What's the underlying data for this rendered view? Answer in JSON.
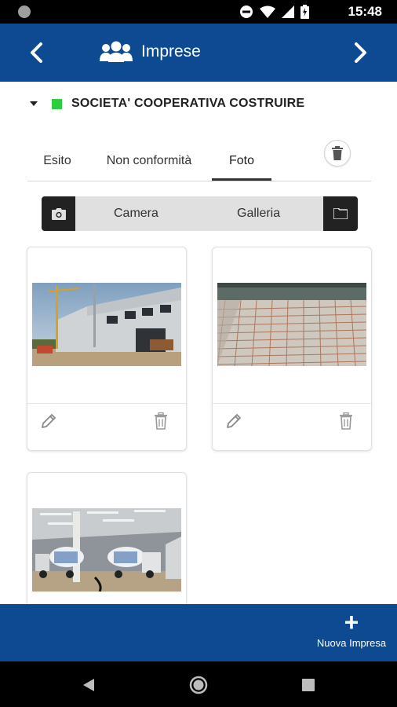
{
  "status_bar": {
    "time": "15:48",
    "icons": [
      "dnd-icon",
      "wifi-icon",
      "signal-icon",
      "battery-icon"
    ]
  },
  "app_bar": {
    "title": "Imprese",
    "icon": "group-icon",
    "colors": {
      "background": "#0d4a91",
      "foreground": "#ffffff"
    }
  },
  "company": {
    "name": "SOCIETA' COOPERATIVA COSTRUIRE",
    "status_color": "#2ecc40"
  },
  "tabs": [
    {
      "label": "Esito",
      "active": false
    },
    {
      "label": "Non conformità",
      "active": false
    },
    {
      "label": "Foto",
      "active": true
    }
  ],
  "source_selector": {
    "camera_label": "Camera",
    "gallery_label": "Galleria"
  },
  "photos": [
    {
      "subject": "industrial building under construction with crane"
    },
    {
      "subject": "rebar mesh on concrete floor"
    },
    {
      "subject": "concrete mixer trucks inside warehouse"
    }
  ],
  "bottom_bar": {
    "add_label": "Nuova Impresa"
  }
}
